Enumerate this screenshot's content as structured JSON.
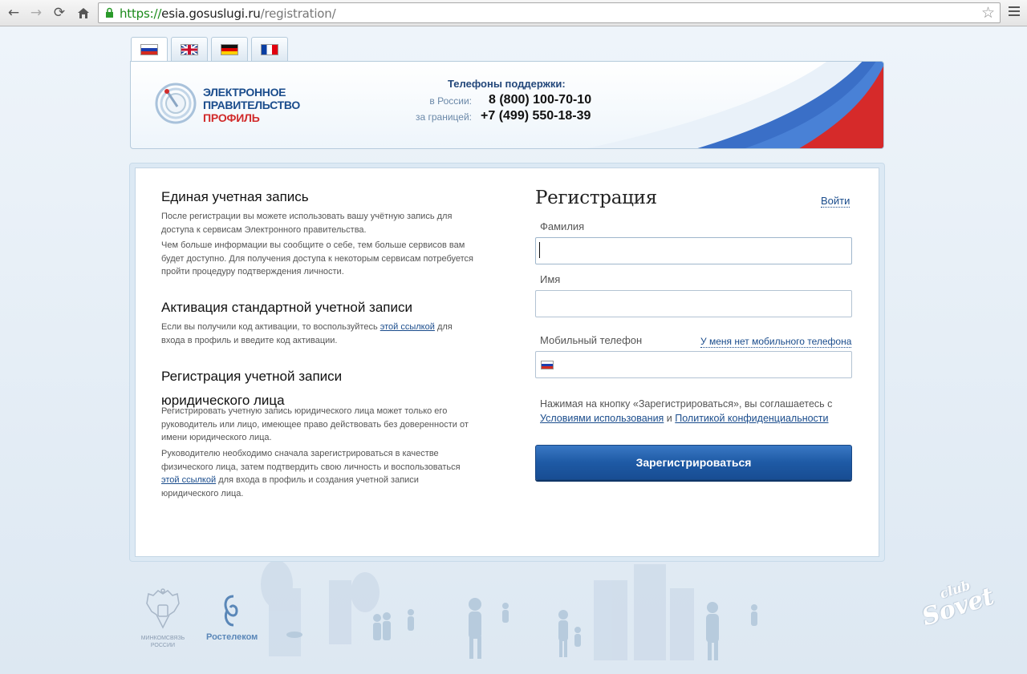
{
  "browser": {
    "url_scheme": "https://",
    "url_host": "esia.gosuslugi.ru",
    "url_path": "/registration/",
    "icons": [
      "back-icon",
      "forward-icon",
      "reload-icon",
      "home-icon",
      "lock-icon",
      "star-icon",
      "menu-icon"
    ]
  },
  "languages": [
    "Русский",
    "English",
    "Deutsch",
    "Français"
  ],
  "header": {
    "logo_line1": "ЭЛЕКТРОННОЕ",
    "logo_line2": "ПРАВИТЕЛЬСТВО",
    "logo_line3": "ПРОФИЛЬ",
    "support_title": "Телефоны поддержки:",
    "russia_label": "в России:",
    "russia_phone": "8 (800) 100-70-10",
    "abroad_label": "за границей:",
    "abroad_phone": "+7 (499) 550-18-39"
  },
  "info": {
    "s1_title": "Единая учетная запись",
    "s1_p1": "После регистрации вы можете использовать вашу учётную запись для доступа к сервисам Электронного правительства.",
    "s1_p2": "Чем больше информации вы сообщите о себе, тем больше сервисов вам будет доступно. Для получения доступа к некоторым сервисам потребуется пройти процедуру подтверждения личности.",
    "s2_title": "Активация стандартной учетной записи",
    "s2_p_before": "Если вы получили код активации, то воспользуйтесь ",
    "s2_link": "этой ссылкой",
    "s2_p_after": " для входа в профиль и введите код активации.",
    "s3_title_line1": "Регистрация учетной записи",
    "s3_title_line2": "юридического лица",
    "s3_p1": "Регистрировать учетную запись юридического лица может только его руководитель или лицо, имеющее право действовать без доверенности от имени юридического лица.",
    "s3_p2_before": "Руководителю необходимо сначала зарегистрироваться в качестве физического лица, затем подтвердить свою личность и воспользоваться ",
    "s3_link": "этой ссылкой",
    "s3_p2_after": " для входа в профиль и создания учетной записи юридического лица."
  },
  "form": {
    "title": "Регистрация",
    "login_link": "Войти",
    "surname_label": "Фамилия",
    "surname_value": "",
    "name_label": "Имя",
    "name_value": "",
    "phone_label": "Мобильный телефон",
    "phone_value": "",
    "no_phone_link": "У меня нет мобильного телефона",
    "agree_before": "Нажимая на кнопку «Зарегистрироваться», вы соглашаетесь с ",
    "terms_link": "Условиями использования",
    "agree_and": " и ",
    "privacy_link": "Политикой конфиденциальности",
    "submit": "Зарегистрироваться"
  },
  "footer": {
    "ministry_line1": "МИНКОМСВЯЗЬ",
    "ministry_line2": "РОССИИ",
    "rostelecom": "Ростелеком",
    "watermark_top": "club",
    "watermark_main": "Sovet"
  },
  "colors": {
    "accent": "#1e5aa5",
    "link": "#1a4c8c",
    "brand_red": "#d12b2b"
  }
}
